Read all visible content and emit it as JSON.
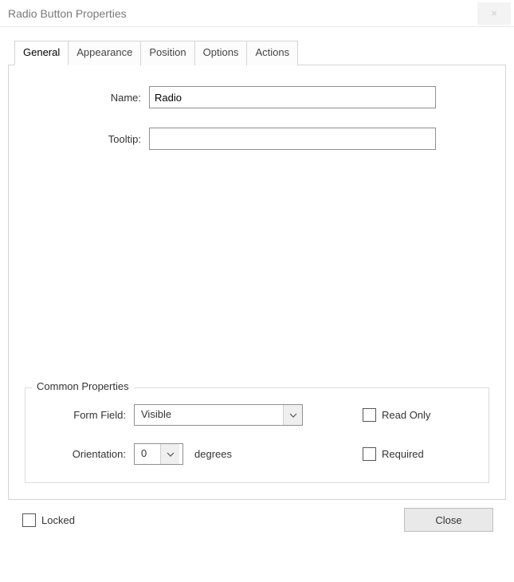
{
  "window": {
    "title": "Radio Button Properties",
    "close_glyph": "×"
  },
  "tabs": [
    {
      "label": "General",
      "active": true
    },
    {
      "label": "Appearance",
      "active": false
    },
    {
      "label": "Position",
      "active": false
    },
    {
      "label": "Options",
      "active": false
    },
    {
      "label": "Actions",
      "active": false
    }
  ],
  "general": {
    "name_label": "Name:",
    "name_value": "Radio",
    "tooltip_label": "Tooltip:",
    "tooltip_value": ""
  },
  "common": {
    "legend": "Common Properties",
    "form_field_label": "Form Field:",
    "form_field_value": "Visible",
    "orientation_label": "Orientation:",
    "orientation_value": "0",
    "degrees_label": "degrees",
    "read_only_label": "Read Only",
    "read_only_checked": false,
    "required_label": "Required",
    "required_checked": false
  },
  "footer": {
    "locked_label": "Locked",
    "locked_checked": false,
    "close_label": "Close"
  }
}
